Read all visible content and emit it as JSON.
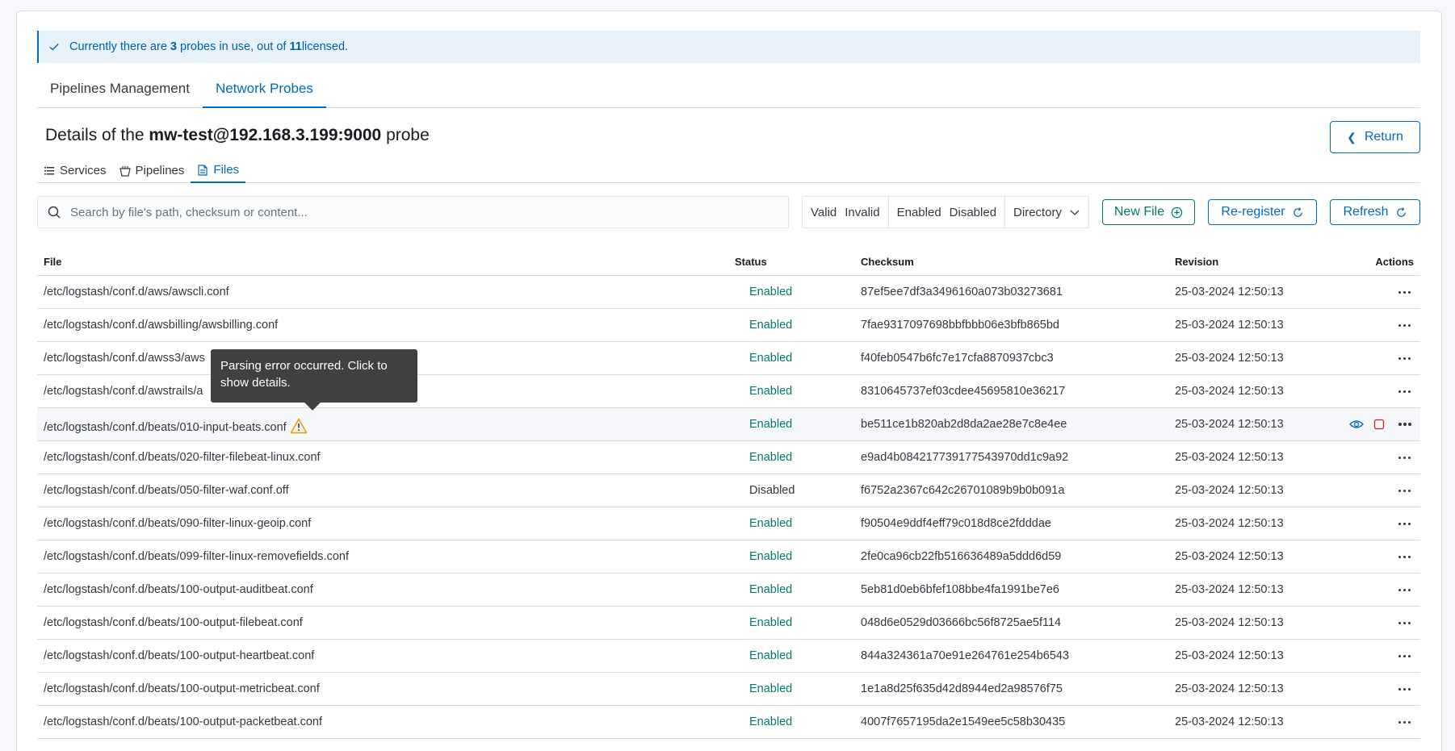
{
  "callout": {
    "prefix": "Currently there are ",
    "in_use": "3",
    "middle": " probes in use, out of ",
    "licensed": "11",
    "suffix": " licensed."
  },
  "main_tabs": [
    {
      "label": "Pipelines Management",
      "active": false
    },
    {
      "label": "Network Probes",
      "active": true
    }
  ],
  "title": {
    "prefix": "Details of the ",
    "probe": "mw-test@192.168.3.199:9000",
    "suffix": " probe"
  },
  "return_label": "Return",
  "sub_tabs": [
    {
      "label": "Services",
      "icon": "list-icon"
    },
    {
      "label": "Pipelines",
      "icon": "pipeline-icon"
    },
    {
      "label": "Files",
      "icon": "document-icon",
      "active": true
    }
  ],
  "search": {
    "placeholder": "Search by file's path, checksum or content..."
  },
  "filters": {
    "valid": "Valid",
    "invalid": "Invalid",
    "enabled": "Enabled",
    "disabled": "Disabled",
    "directory": "Directory"
  },
  "buttons": {
    "new_file": "New File",
    "reregister": "Re-register",
    "refresh": "Refresh"
  },
  "table": {
    "headers": {
      "file": "File",
      "status": "Status",
      "checksum": "Checksum",
      "revision": "Revision",
      "actions": "Actions"
    },
    "rows": [
      {
        "file": "/etc/logstash/conf.d/aws/awscli.conf",
        "status": "Enabled",
        "checksum": "87ef5ee7df3a3496160a073b03273681",
        "revision": "25-03-2024 12:50:13"
      },
      {
        "file": "/etc/logstash/conf.d/awsbilling/awsbilling.conf",
        "status": "Enabled",
        "checksum": "7fae9317097698bbfbbb06e3bfb865bd",
        "revision": "25-03-2024 12:50:13"
      },
      {
        "file": "/etc/logstash/conf.d/awss3/aws",
        "status": "Enabled",
        "checksum": "f40feb0547b6fc7e17cfa8870937cbc3",
        "revision": "25-03-2024 12:50:13"
      },
      {
        "file": "/etc/logstash/conf.d/awstrails/a",
        "status": "Enabled",
        "checksum": "8310645737ef03cdee45695810e36217",
        "revision": "25-03-2024 12:50:13"
      },
      {
        "file": "/etc/logstash/conf.d/beats/010-input-beats.conf",
        "status": "Enabled",
        "checksum": "be511ce1b820ab2d8da2ae28e7c8e4ee",
        "revision": "25-03-2024 12:50:13",
        "warning": true
      },
      {
        "file": "/etc/logstash/conf.d/beats/020-filter-filebeat-linux.conf",
        "status": "Enabled",
        "checksum": "e9ad4b084217739177543970dd1c9a92",
        "revision": "25-03-2024 12:50:13"
      },
      {
        "file": "/etc/logstash/conf.d/beats/050-filter-waf.conf.off",
        "status": "Disabled",
        "checksum": "f6752a2367c642c26701089b9b0b091a",
        "revision": "25-03-2024 12:50:13"
      },
      {
        "file": "/etc/logstash/conf.d/beats/090-filter-linux-geoip.conf",
        "status": "Enabled",
        "checksum": "f90504e9ddf4eff79c018d8ce2fdddae",
        "revision": "25-03-2024 12:50:13"
      },
      {
        "file": "/etc/logstash/conf.d/beats/099-filter-linux-removefields.conf",
        "status": "Enabled",
        "checksum": "2fe0ca96cb22fb516636489a5ddd6d59",
        "revision": "25-03-2024 12:50:13"
      },
      {
        "file": "/etc/logstash/conf.d/beats/100-output-auditbeat.conf",
        "status": "Enabled",
        "checksum": "5eb81d0eb6bfef108bbe4fa1991be7e6",
        "revision": "25-03-2024 12:50:13"
      },
      {
        "file": "/etc/logstash/conf.d/beats/100-output-filebeat.conf",
        "status": "Enabled",
        "checksum": "048d6e0529d03666bc56f8725ae5f114",
        "revision": "25-03-2024 12:50:13"
      },
      {
        "file": "/etc/logstash/conf.d/beats/100-output-heartbeat.conf",
        "status": "Enabled",
        "checksum": "844a324361a70e91e264761e254b6543",
        "revision": "25-03-2024 12:50:13"
      },
      {
        "file": "/etc/logstash/conf.d/beats/100-output-metricbeat.conf",
        "status": "Enabled",
        "checksum": "1e1a8d25f635d42d8944ed2a98576f75",
        "revision": "25-03-2024 12:50:13"
      },
      {
        "file": "/etc/logstash/conf.d/beats/100-output-packetbeat.conf",
        "status": "Enabled",
        "checksum": "4007f7657195da2e1549ee5c58b30435",
        "revision": "25-03-2024 12:50:13"
      }
    ]
  },
  "tooltip": {
    "text": "Parsing error occurred. Click to show details."
  },
  "colors": {
    "primary": "#006bb8",
    "success": "#00796b",
    "danger": "#bd271e",
    "warning": "#e8a000"
  }
}
